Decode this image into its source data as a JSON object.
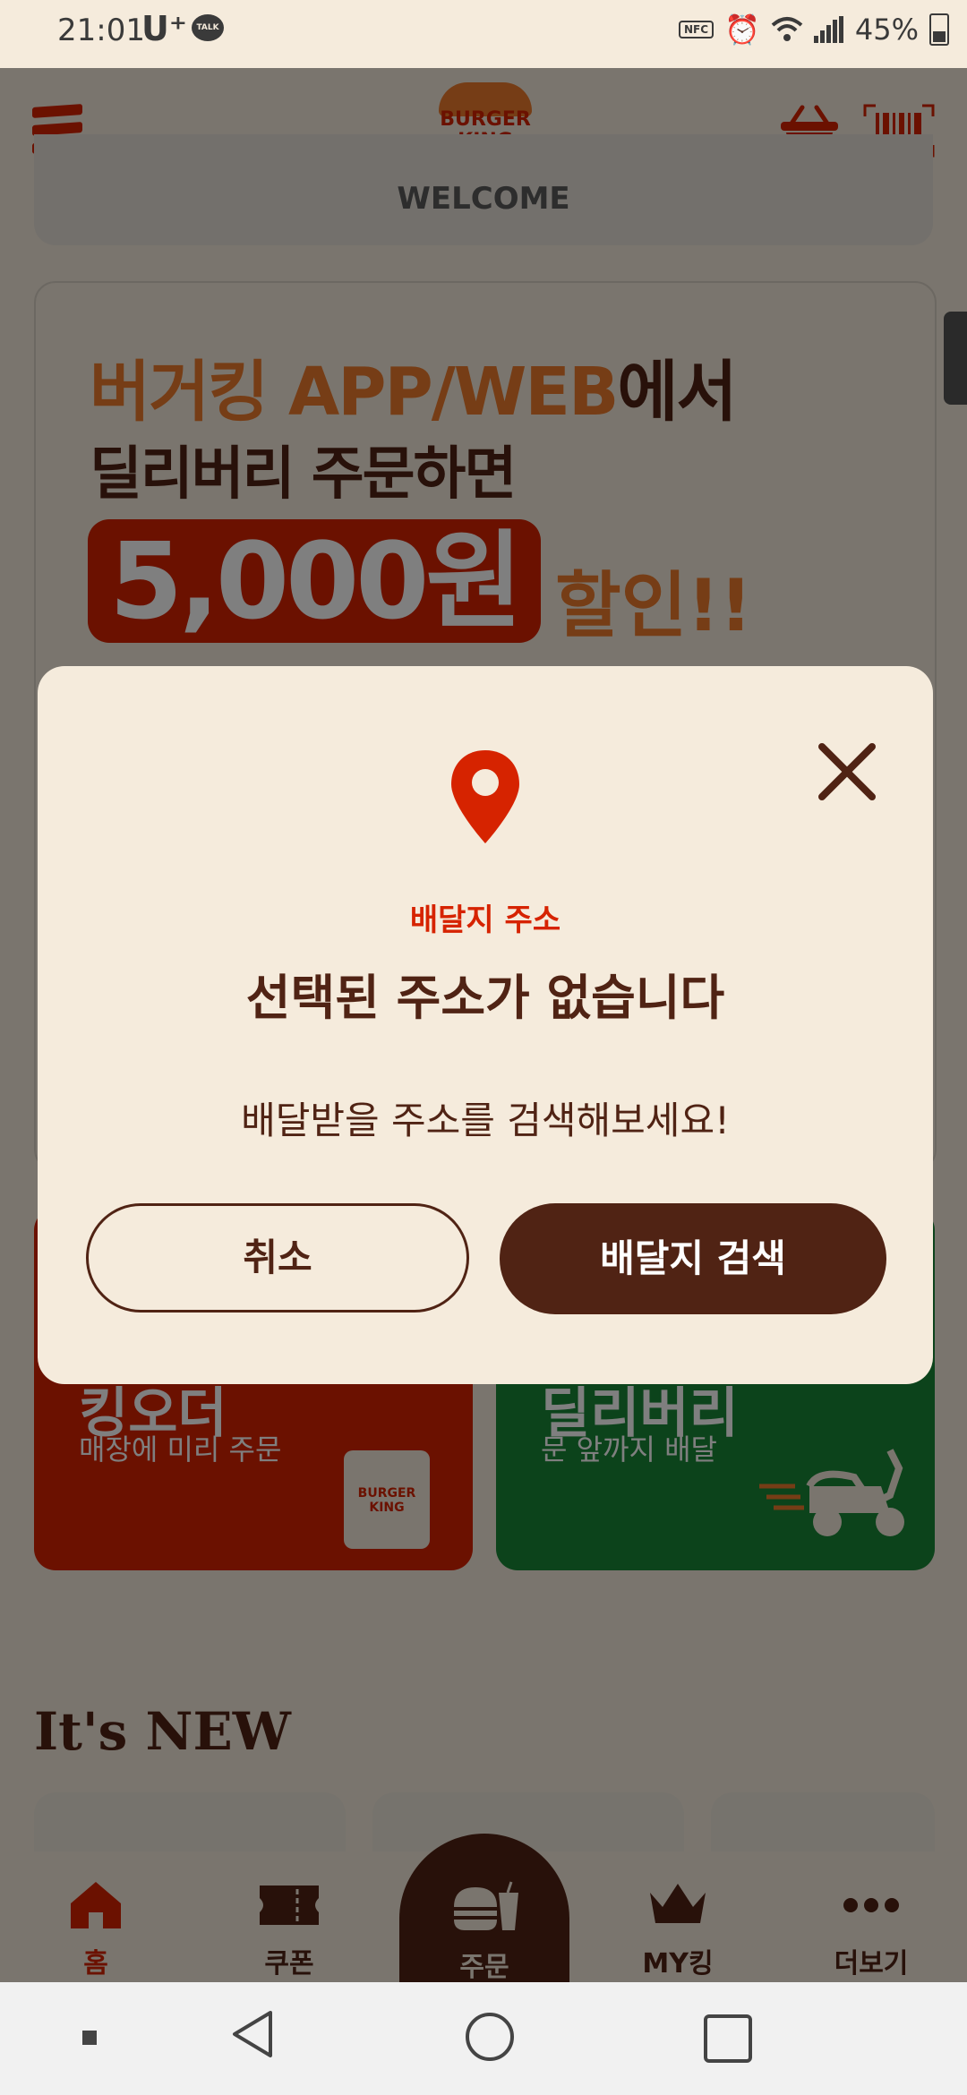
{
  "status_bar": {
    "time": "21:01",
    "carrier": "U⁺",
    "talk_badge": "TALK",
    "nfc": "NFC",
    "battery": "45%"
  },
  "header": {
    "logo_text": "BURGER KING"
  },
  "welcome": {
    "text": "WELCOME"
  },
  "banner": {
    "line1_accent": "버거킹 APP/WEB",
    "line1_rest": "에서",
    "line2": "딜리버리 주문하면",
    "amount": "5,000원",
    "discount": "할인!!"
  },
  "order_cards": {
    "pickup": {
      "title": "킹오더",
      "subtitle": "매장에 미리 주문",
      "bag_text": "BURGER KING"
    },
    "delivery": {
      "title": "딜리버리",
      "subtitle": "문 앞까지 배달"
    }
  },
  "new_section": {
    "heading": "It's NEW"
  },
  "bottom_nav": {
    "home": "홈",
    "coupon": "쿠폰",
    "order": "주문",
    "myking": "MY킹",
    "more": "더보기"
  },
  "modal": {
    "label": "배달지 주소",
    "title": "선택된 주소가 없습니다",
    "message": "배달받을 주소를 검색해보세요!",
    "cancel_label": "취소",
    "search_label": "배달지 검색"
  },
  "colors": {
    "background": "#f5ebdc",
    "brand_red": "#d62300",
    "brand_brown": "#502314",
    "brand_orange": "#ed7b2d",
    "delivery_green": "#198737"
  }
}
